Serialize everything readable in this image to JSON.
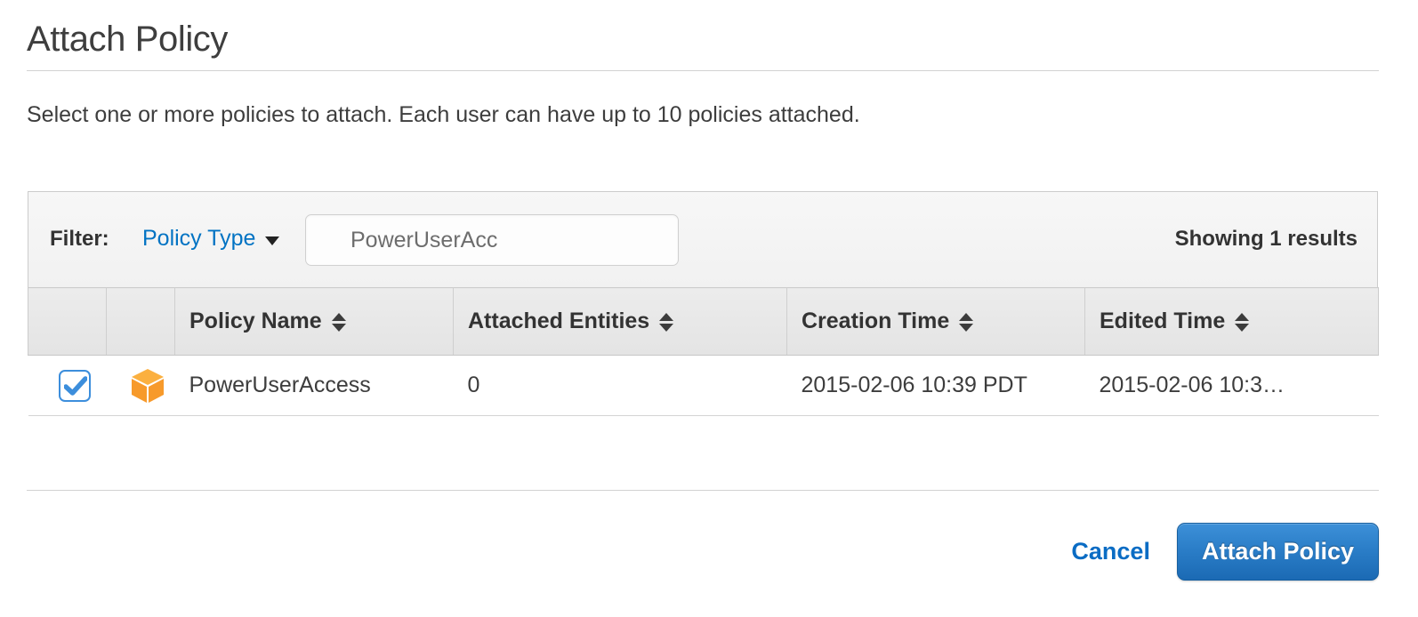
{
  "dialog": {
    "title": "Attach Policy",
    "description": "Select one or more policies to attach. Each user can have up to 10 policies attached."
  },
  "filter": {
    "label": "Filter:",
    "type_label": "Policy Type",
    "caret_icon": "chevron-down-icon",
    "search_value": "PowerUserAcc",
    "search_placeholder": "",
    "results_text": "Showing 1 results"
  },
  "table": {
    "columns": [
      {
        "key": "select",
        "label": ""
      },
      {
        "key": "icon",
        "label": ""
      },
      {
        "key": "policy_name",
        "label": "Policy Name",
        "sortable": true
      },
      {
        "key": "attached_entities",
        "label": "Attached Entities",
        "sortable": true
      },
      {
        "key": "creation_time",
        "label": "Creation Time",
        "sortable": true
      },
      {
        "key": "edited_time",
        "label": "Edited Time",
        "sortable": true
      }
    ],
    "rows": [
      {
        "selected": true,
        "icon": "policy-cube-icon",
        "policy_name": "PowerUserAccess",
        "attached_entities": "0",
        "creation_time": "2015-02-06 10:39 PDT",
        "edited_time": "2015-02-06 10:3…"
      }
    ]
  },
  "footer": {
    "cancel_label": "Cancel",
    "submit_label": "Attach Policy"
  },
  "colors": {
    "link_blue": "#0273c3",
    "button_blue": "#2b7ec8",
    "checkbox_blue": "#3c8edc",
    "policy_icon_orange": "#f79a2b",
    "text_dark": "#3d3d3d"
  }
}
